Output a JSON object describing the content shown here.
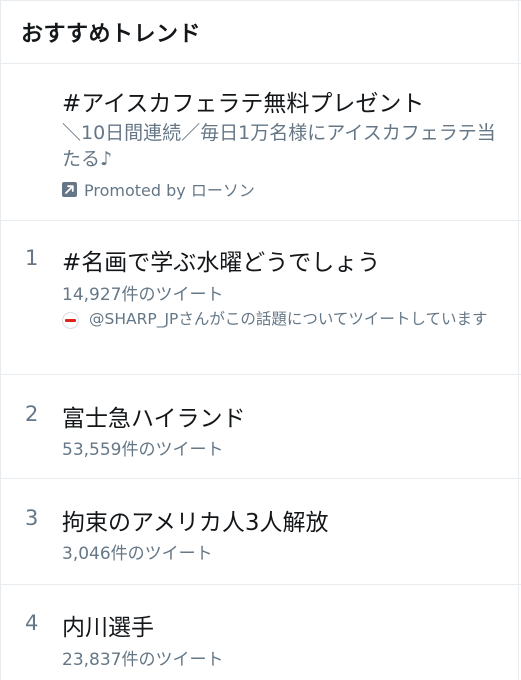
{
  "header": {
    "title": "おすすめトレンド"
  },
  "promoted": {
    "name": "#アイスカフェラテ無料プレゼント",
    "description": "＼10日間連続／毎日1万名様にアイスカフェラテ当たる♪",
    "promoted_label": "Promoted by ローソン",
    "icon": "promoted-arrow-icon"
  },
  "trends": [
    {
      "rank": "1",
      "name": "#名画で学ぶ水曜どうでしょう",
      "tweet_count": "14,927件のツイート",
      "context": "@SHARP_JPさんがこの話題についてツイートしています",
      "context_avatar": "sharp-logo-avatar"
    },
    {
      "rank": "2",
      "name": "富士急ハイランド",
      "tweet_count": "53,559件のツイート"
    },
    {
      "rank": "3",
      "name": "拘束のアメリカ人3人解放",
      "tweet_count": "3,046件のツイート"
    },
    {
      "rank": "4",
      "name": "内川選手",
      "tweet_count": "23,837件のツイート"
    }
  ],
  "colors": {
    "text_primary": "#14171a",
    "text_secondary": "#657786",
    "divider": "#e6ecf0",
    "sharp_red": "#e0231a"
  }
}
